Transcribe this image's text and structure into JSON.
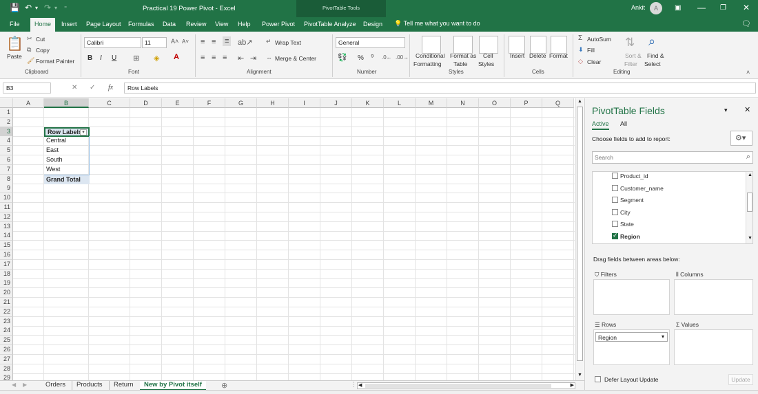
{
  "titlebar": {
    "title": "Practical 19 Power Pivot  -  Excel",
    "context": "PivotTable Tools",
    "user": "Ankit",
    "avatar": "A",
    "save_icon": "save-icon",
    "undo_icon": "undo-icon",
    "redo_icon": "redo-icon"
  },
  "tabs": {
    "file": "File",
    "home": "Home",
    "insert": "Insert",
    "page_layout": "Page Layout",
    "formulas": "Formulas",
    "data": "Data",
    "review": "Review",
    "view": "View",
    "help": "Help",
    "power_pivot": "Power Pivot",
    "pivot_analyze": "PivotTable Analyze",
    "design": "Design",
    "tell_me": "Tell me what you want to do"
  },
  "ribbon": {
    "clipboard": {
      "label": "Clipboard",
      "paste": "Paste",
      "cut": "Cut",
      "copy": "Copy",
      "format_painter": "Format Painter"
    },
    "font": {
      "label": "Font",
      "name": "Calibri",
      "size": "11",
      "bold": "B",
      "italic": "I",
      "underline": "U"
    },
    "alignment": {
      "label": "Alignment",
      "wrap": "Wrap Text",
      "merge": "Merge & Center"
    },
    "number": {
      "label": "Number",
      "format": "General",
      "percent": "%",
      "comma": "⁹"
    },
    "styles": {
      "label": "Styles",
      "cond1": "Conditional",
      "cond2": "Formatting",
      "fmt1": "Format as",
      "fmt2": "Table",
      "cell1": "Cell",
      "cell2": "Styles"
    },
    "cells": {
      "label": "Cells",
      "insert": "Insert",
      "delete": "Delete",
      "format": "Format"
    },
    "editing": {
      "label": "Editing",
      "autosum": "AutoSum",
      "fill": "Fill",
      "clear": "Clear",
      "sort1": "Sort &",
      "sort2": "Filter",
      "find1": "Find &",
      "find2": "Select"
    }
  },
  "formula": {
    "namebox": "B3",
    "content": "Row Labels"
  },
  "grid": {
    "columns": [
      "A",
      "B",
      "C",
      "D",
      "E",
      "F",
      "G",
      "H",
      "I",
      "J",
      "K",
      "L",
      "M",
      "N",
      "O",
      "P",
      "Q"
    ],
    "rows": [
      "1",
      "2",
      "3",
      "4",
      "5",
      "6",
      "7",
      "8",
      "9",
      "10",
      "11",
      "12",
      "13",
      "14",
      "15",
      "16",
      "17",
      "18",
      "19",
      "20",
      "21",
      "22",
      "23",
      "24",
      "25",
      "26",
      "27",
      "28",
      "29"
    ],
    "pivot": {
      "header": "Row Labels",
      "items": [
        "Central",
        "East",
        "South",
        "West"
      ],
      "total": "Grand Total"
    }
  },
  "sheets": [
    "Orders",
    "Products",
    "Return",
    "New by Pivot itself"
  ],
  "pane": {
    "title": "PivotTable Fields",
    "tab_active": "Active",
    "tab_all": "All",
    "choose": "Choose fields to add to report:",
    "search_placeholder": "Search",
    "fields": [
      {
        "name": "Product_id",
        "checked": false
      },
      {
        "name": "Customer_name",
        "checked": false
      },
      {
        "name": "Segment",
        "checked": false
      },
      {
        "name": "City",
        "checked": false
      },
      {
        "name": "State",
        "checked": false
      },
      {
        "name": "Region",
        "checked": true
      }
    ],
    "drag": "Drag fields between areas below:",
    "filters": "Filters",
    "columns": "Columns",
    "rows": "Rows",
    "values": "Values",
    "rows_item": "Region",
    "defer": "Defer Layout Update",
    "update": "Update"
  }
}
